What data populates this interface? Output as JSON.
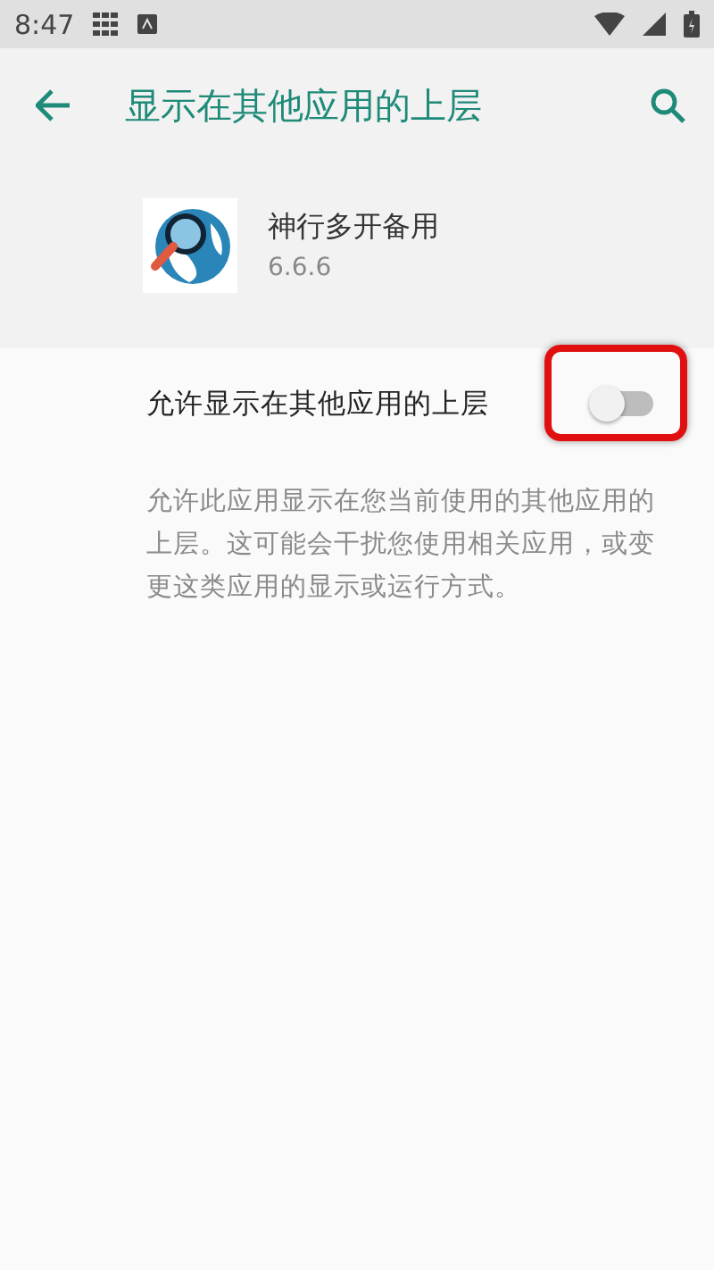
{
  "status_bar": {
    "time": "8:47"
  },
  "toolbar": {
    "title": "显示在其他应用的上层"
  },
  "app": {
    "name": "神行多开备用",
    "version": "6.6.6"
  },
  "setting": {
    "label": "允许显示在其他应用的上层",
    "on": false,
    "highlighted": true
  },
  "description": "允许此应用显示在您当前使用的其他应用的上层。这可能会干扰您使用相关应用，或变更这类应用的显示或运行方式。"
}
